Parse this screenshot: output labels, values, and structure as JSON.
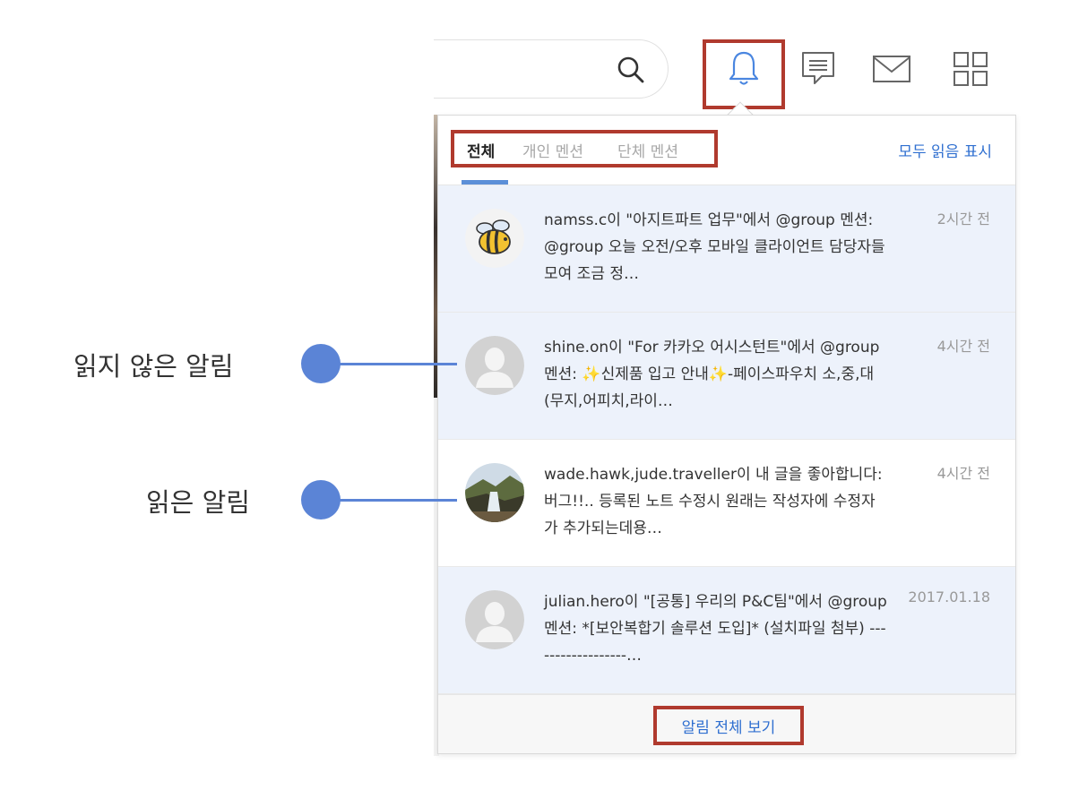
{
  "topbar": {
    "icons": [
      "search-icon",
      "bell-icon",
      "comment-icon",
      "mail-icon",
      "apps-grid-icon"
    ]
  },
  "panel": {
    "tabs": [
      {
        "label": "전체",
        "active": true
      },
      {
        "label": "개인 멘션",
        "active": false
      },
      {
        "label": "단체 멘션",
        "active": false
      }
    ],
    "mark_all_read": "모두 읽음 표시",
    "notifications": [
      {
        "text": "namss.c이 \"아지트파트 업무\"에서 @group 멘션: @group 오늘 오전/오후 모바일 클라이언트 담당자들 모여 조금 정…",
        "time": "2시간 전",
        "unread": true,
        "avatar": "bee-avatar"
      },
      {
        "text": "shine.on이 \"For 카카오 어시스턴트\"에서 @group 멘션: ✨신제품 입고 안내✨-페이스파우치 소,중,대 (무지,어피치,라이…",
        "time": "4시간 전",
        "unread": true,
        "avatar": "default-avatar"
      },
      {
        "text": "wade.hawk,jude.traveller이 내 글을 좋아합니다: 버그!!.. 등록된 노트 수정시 원래는 작성자에 수정자가 추가되는데용…",
        "time": "4시간 전",
        "unread": false,
        "avatar": "landscape-avatar"
      },
      {
        "text": "julian.hero이 \"[공통] 우리의 P&C팀\"에서 @group 멘션: *[보안복합기 솔루션 도입]* (설치파일 첨부) ------------------…",
        "time": "2017.01.18",
        "unread": true,
        "avatar": "default-avatar"
      }
    ],
    "view_all": "알림 전체 보기"
  },
  "annotations": {
    "unread_label": "읽지 않은 알림",
    "read_label": "읽은 알림"
  },
  "colors": {
    "accent_blue": "#2f6fd0",
    "unread_bg": "#edf2fb",
    "highlight_red": "#b03a2e",
    "annotation_blue": "#5b84d6"
  }
}
